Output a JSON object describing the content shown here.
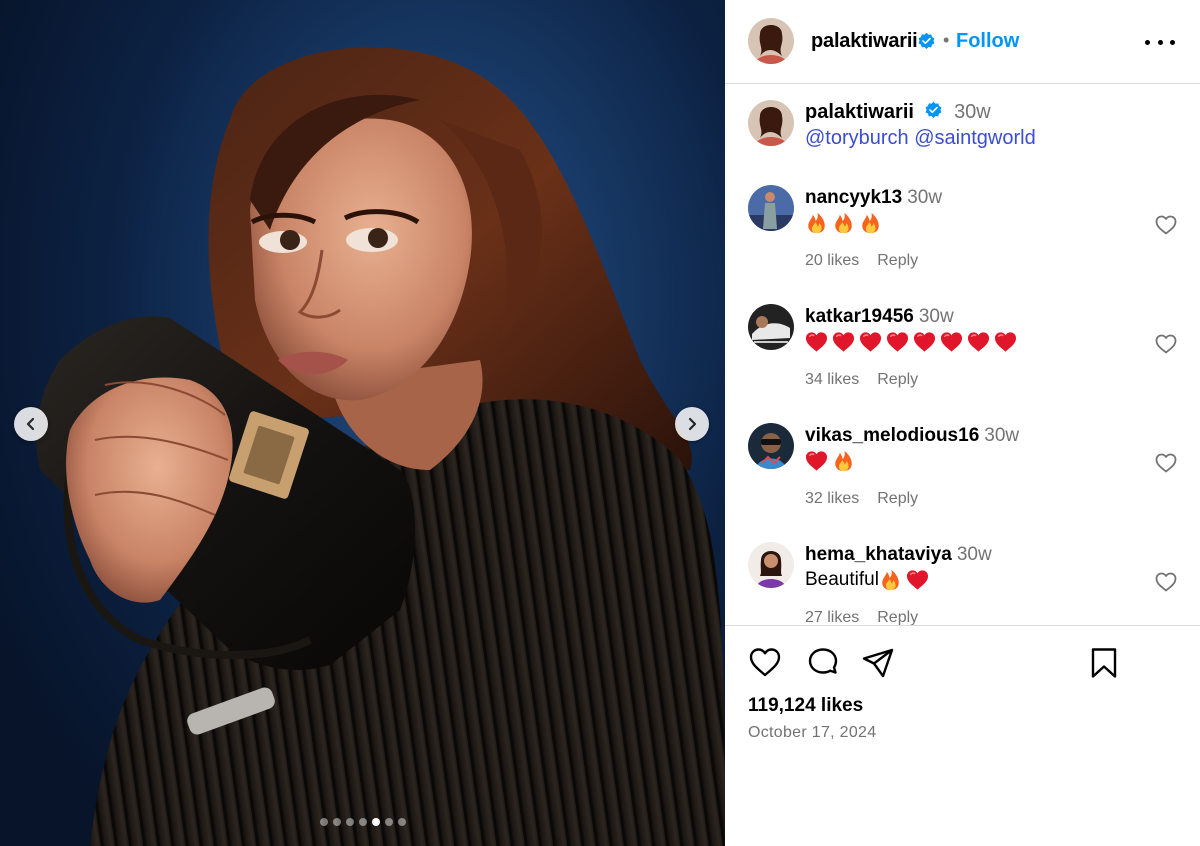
{
  "post": {
    "username": "palaktiwarii",
    "follow_label": "Follow",
    "separator": "•",
    "caption": {
      "username": "palaktiwarii",
      "time": "30w",
      "mention_1": "@toryburch",
      "mention_2": "@saintgworld"
    },
    "slide_count": 7,
    "active_slide": 5
  },
  "comments": [
    {
      "username": "nancyyk13",
      "time": "30w",
      "text": "",
      "emoji": [
        "fire",
        "fire",
        "fire"
      ],
      "likes": "20 likes",
      "reply": "Reply"
    },
    {
      "username": "katkar19456",
      "time": "30w",
      "text": "",
      "emoji": [
        "heart",
        "heart",
        "heart",
        "heart",
        "heart",
        "heart",
        "heart",
        "heart"
      ],
      "likes": "34 likes",
      "reply": "Reply"
    },
    {
      "username": "vikas_melodious16",
      "time": "30w",
      "text": "",
      "emoji": [
        "heart",
        "fire"
      ],
      "likes": "32 likes",
      "reply": "Reply"
    },
    {
      "username": "hema_khataviya",
      "time": "30w",
      "text": "Beautiful",
      "emoji": [
        "fire",
        "heart"
      ],
      "likes": "27 likes",
      "reply": "Reply"
    }
  ],
  "footer": {
    "likes": "119,124 likes",
    "date": "October 17, 2024"
  },
  "colors": {
    "follow": "#0095f6",
    "verified": "#0095f6",
    "mention": "#3b4dd0",
    "muted": "#737373",
    "divider": "#dbdbdb"
  },
  "icons": {
    "heart": "heart-icon",
    "comment": "comment-icon",
    "share": "share-icon",
    "save": "bookmark-icon",
    "more": "more-options-icon"
  }
}
